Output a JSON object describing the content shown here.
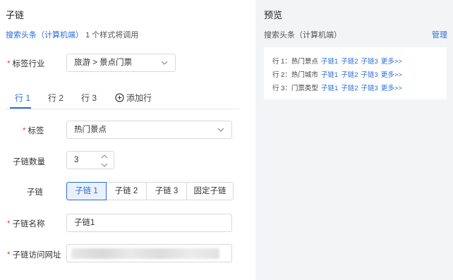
{
  "left": {
    "title": "子链",
    "usage_link": "搜索头条（计算机端）",
    "usage_text": "1 个样式将调用",
    "industry": {
      "label": "标签行业",
      "value": "旅游 > 景点门票"
    },
    "tabs": [
      "行 1",
      "行 2",
      "行 3"
    ],
    "add_tab_label": "添加行",
    "tag": {
      "label": "标签",
      "value": "热门景点"
    },
    "count": {
      "label": "子链数量",
      "value": "3"
    },
    "sublink": {
      "label": "子链",
      "options": [
        "子链 1",
        "子链 2",
        "子链 3",
        "固定子链"
      ],
      "selected": "子链 1"
    },
    "sublink_name": {
      "label": "子链名称",
      "value": "子链1"
    },
    "sublink_url": {
      "label": "子链访问网址"
    }
  },
  "preview": {
    "title": "预览",
    "subtitle": "搜索头条（计算机端）",
    "manage": "管理",
    "rows": [
      {
        "prefix": "行 1：热门景点",
        "links": [
          "子链1",
          "子链2",
          "子链3",
          "更多>>"
        ]
      },
      {
        "prefix": "行 2：热门城市",
        "links": [
          "子链1",
          "子链2",
          "子链3",
          "更多>>"
        ]
      },
      {
        "prefix": "行 3：门票类型",
        "links": [
          "子链1",
          "子链2",
          "子链3",
          "更多>>"
        ]
      }
    ]
  },
  "colors": {
    "accent": "#2a6dd9",
    "required": "#e2442f",
    "preview_bg": "#f3f4f6"
  },
  "icons": {
    "select_arrow": "chevron-down-icon",
    "add": "plus-circle-icon",
    "stepper_up": "chevron-up-icon",
    "stepper_down": "chevron-down-icon"
  }
}
